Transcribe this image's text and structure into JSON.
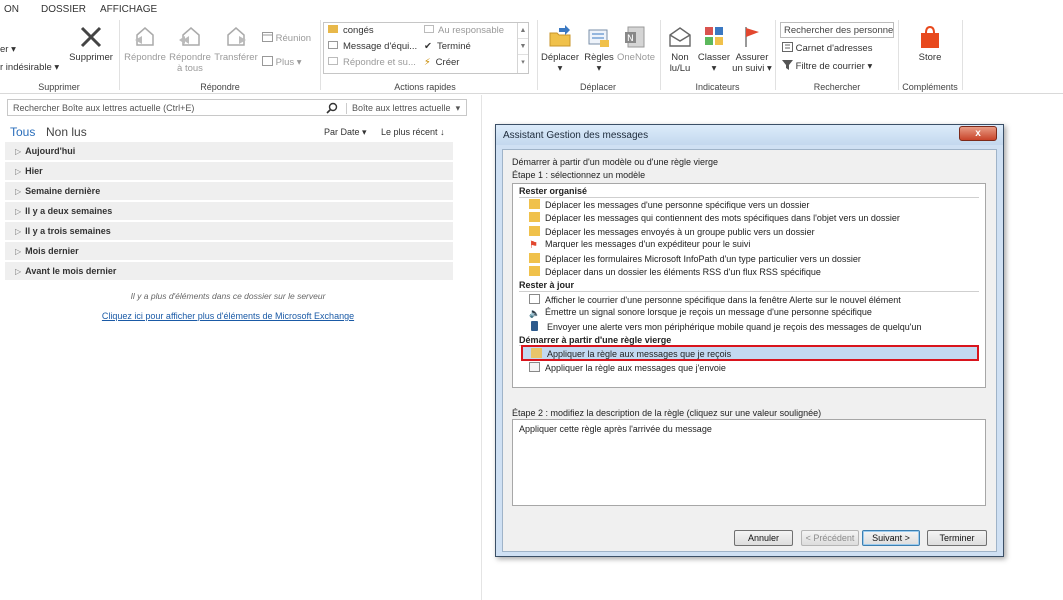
{
  "menu": {
    "tabs": [
      "ON",
      "DOSSIER",
      "AFFICHAGE"
    ]
  },
  "ribbon": {
    "supprimer": {
      "clean_suffix": "er",
      "junk": "r indésirable",
      "delete": "Supprimer",
      "label": "Supprimer"
    },
    "repondre": {
      "reply": "Répondre",
      "reply_all_1": "Répondre",
      "reply_all_2": "à tous",
      "forward": "Transférer",
      "meeting": "Réunion",
      "more": "Plus",
      "label": "Répondre"
    },
    "quick_steps": {
      "items": [
        "congés",
        "Message d'équi...",
        "Répondre et su...",
        "Au responsable",
        "Terminé",
        "Créer"
      ],
      "label": "Actions rapides"
    },
    "deplacer": {
      "move": "Déplacer",
      "rules": "Règles",
      "onenote": "OneNote",
      "label": "Déplacer"
    },
    "indicateurs": {
      "unread_1": "Non",
      "unread_2": "lu/Lu",
      "categorize": "Classer",
      "followup_1": "Assurer",
      "followup_2": "un suivi",
      "label": "Indicateurs"
    },
    "rechercher": {
      "search_people": "Rechercher des personnes",
      "address_book": "Carnet d'adresses",
      "filter": "Filtre de courrier",
      "label": "Rechercher"
    },
    "complements": {
      "store": "Store",
      "label": "Compléments"
    }
  },
  "mail": {
    "search_placeholder": "Rechercher Boîte aux lettres actuelle (Ctrl+E)",
    "scope": "Boîte aux lettres actuelle",
    "filter_all": "Tous",
    "filter_unread": "Non lus",
    "sort": "Par Date",
    "order": "Le plus récent",
    "groups": [
      "Aujourd'hui",
      "Hier",
      "Semaine dernière",
      "Il y a deux semaines",
      "Il y a trois semaines",
      "Mois dernier",
      "Avant le mois dernier"
    ],
    "more_info": "Il y a plus d'éléments dans ce dossier sur le serveur",
    "more_link": "Cliquez ici pour afficher plus d'éléments de Microsoft Exchange"
  },
  "dialog": {
    "title": "Assistant Gestion des messages",
    "intro": "Démarrer à partir d'un modèle ou d'une règle vierge",
    "step1": "Étape 1 : sélectionnez un modèle",
    "sections": [
      {
        "title": "Rester organisé",
        "items": [
          "Déplacer les messages d'une personne spécifique vers un dossier",
          "Déplacer les messages qui contiennent des mots spécifiques dans l'objet vers un dossier",
          "Déplacer les messages envoyés à un groupe public vers un dossier",
          "Marquer les messages d'un expéditeur pour le suivi",
          "Déplacer les formulaires Microsoft InfoPath d'un type particulier vers un dossier",
          "Déplacer dans un dossier les éléments RSS d'un flux RSS spécifique"
        ]
      },
      {
        "title": "Rester à jour",
        "items": [
          "Afficher le courrier d'une personne spécifique dans la fenêtre Alerte sur le nouvel élément",
          "Émettre un signal sonore lorsque je reçois un message d'une personne spécifique",
          "Envoyer une alerte vers mon périphérique mobile quand je reçois des messages de quelqu'un"
        ]
      },
      {
        "title": "Démarrer à partir d'une règle vierge",
        "items": [
          "Appliquer la règle aux messages que je reçois",
          "Appliquer la règle aux messages que j'envoie"
        ]
      }
    ],
    "step2": "Étape 2 : modifiez la description de la règle (cliquez sur une valeur soulignée)",
    "description": "Appliquer cette règle après l'arrivée du message",
    "buttons": {
      "cancel": "Annuler",
      "prev": "< Précédent",
      "next": "Suivant >",
      "finish": "Terminer"
    },
    "close": "x"
  }
}
